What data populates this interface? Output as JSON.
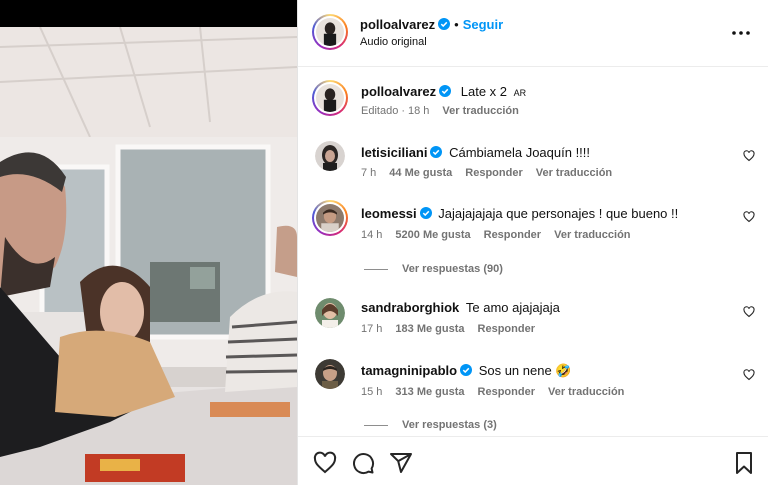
{
  "post": {
    "author": "polloalvarez",
    "follow_label": "Seguir",
    "audio": "Audio original",
    "caption": {
      "username": "polloalvarez",
      "text": "Late x 2",
      "country_code": "AR",
      "edited": "Editado",
      "time": "18 h",
      "translate": "Ver traducción"
    }
  },
  "comments": [
    {
      "username": "letisiciliani",
      "text": "Cámbiamela Joaquín !!!!",
      "time": "7 h",
      "likes": "44 Me gusta",
      "reply": "Responder",
      "translate": "Ver traducción"
    },
    {
      "username": "leomessi",
      "text": "Jajajajajaja que personajes ! que bueno !!",
      "time": "14 h",
      "likes": "5200 Me gusta",
      "reply": "Responder",
      "translate": "Ver traducción",
      "replies": "Ver respuestas (90)"
    },
    {
      "username": "sandraborghiok",
      "text": "Te amo ajajajaja",
      "time": "17 h",
      "likes": "183 Me gusta",
      "reply": "Responder"
    },
    {
      "username": "tamagninipablo",
      "text": "Sos un nene 🤣",
      "time": "15 h",
      "likes": "313 Me gusta",
      "reply": "Responder",
      "translate": "Ver traducción",
      "replies": "Ver respuestas (3)"
    }
  ],
  "colors": {
    "accent": "#0095f6",
    "verified": "#0095f6",
    "muted": "#737373"
  },
  "icons": [
    "verified-badge-icon",
    "more-options-icon",
    "heart-icon",
    "comment-icon",
    "share-icon",
    "save-icon"
  ]
}
